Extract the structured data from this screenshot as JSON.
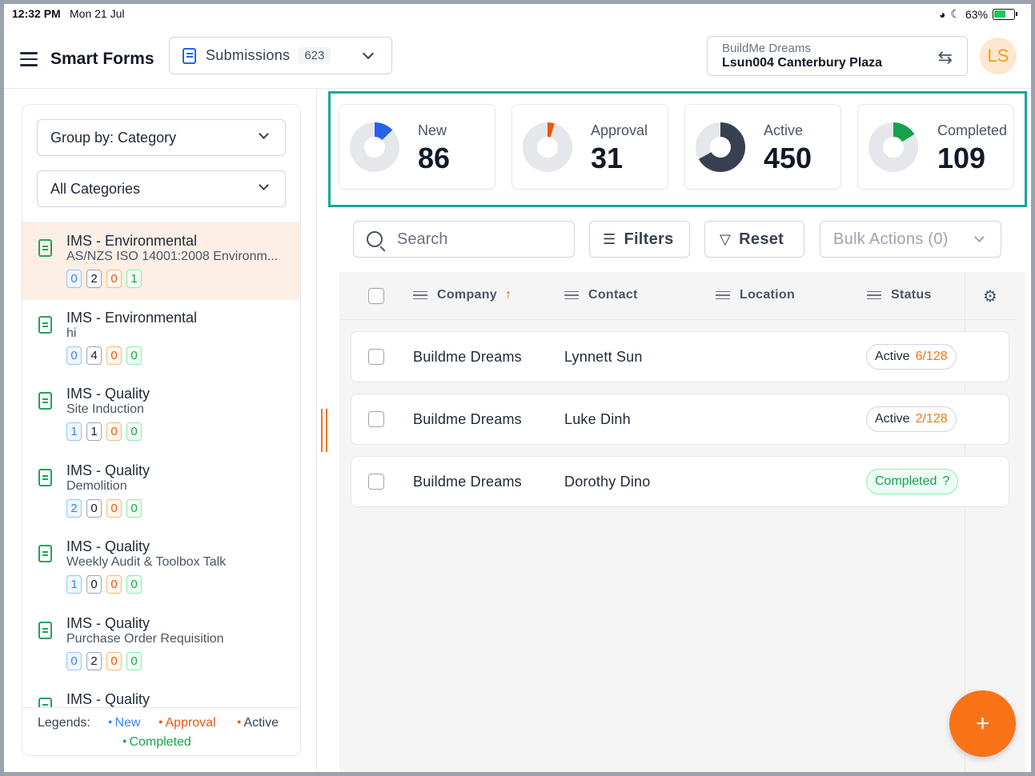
{
  "status_bar": {
    "time": "12:32 PM",
    "date": "Mon 21 Jul",
    "battery": "63%",
    "battery_level": 0.63
  },
  "header": {
    "app_title": "Smart Forms",
    "submissions_label": "Submissions",
    "submissions_count": "623",
    "company": "BuildMe Dreams",
    "project": "Lsun004 Canterbury Plaza",
    "avatar_initials": "LS"
  },
  "sidebar": {
    "group_by": "Group by: Category",
    "category_filter": "All Categories",
    "items": [
      {
        "title": "IMS - Environmental",
        "subtitle": "AS/NZS ISO 14001:2008 Environm...",
        "counts": [
          "0",
          "2",
          "0",
          "1"
        ]
      },
      {
        "title": "IMS - Environmental",
        "subtitle": "hi",
        "counts": [
          "0",
          "4",
          "0",
          "0"
        ]
      },
      {
        "title": "IMS - Quality",
        "subtitle": "Site Induction",
        "counts": [
          "1",
          "1",
          "0",
          "0"
        ]
      },
      {
        "title": "IMS - Quality",
        "subtitle": "Demolition",
        "counts": [
          "2",
          "0",
          "0",
          "0"
        ]
      },
      {
        "title": "IMS - Quality",
        "subtitle": "Weekly Audit & Toolbox Talk",
        "counts": [
          "1",
          "0",
          "0",
          "0"
        ]
      },
      {
        "title": "IMS - Quality",
        "subtitle": "Purchase Order Requisition",
        "counts": [
          "0",
          "2",
          "0",
          "0"
        ]
      },
      {
        "title": "IMS - Quality",
        "subtitle": "",
        "counts": []
      }
    ],
    "legends": {
      "label": "Legends:",
      "new": "New",
      "approval": "Approval",
      "active": "Active",
      "completed": "Completed"
    }
  },
  "stats": [
    {
      "label": "New",
      "value": "86",
      "fraction": 0.128,
      "color": "#2563eb"
    },
    {
      "label": "Approval",
      "value": "31",
      "fraction": 0.046,
      "color": "#ea580c"
    },
    {
      "label": "Active",
      "value": "450",
      "fraction": 0.669,
      "color": "#374151"
    },
    {
      "label": "Completed",
      "value": "109",
      "fraction": 0.162,
      "color": "#16a34a"
    }
  ],
  "toolbar": {
    "search_placeholder": "Search",
    "filters": "Filters",
    "reset": "Reset",
    "bulk_actions": "Bulk Actions (0)"
  },
  "table": {
    "columns": [
      "Company",
      "Contact",
      "Location",
      "Status"
    ],
    "rows": [
      {
        "company": "Buildme Dreams",
        "contact": "Lynnett Sun",
        "location": "",
        "status": "Active",
        "status_count": "6/128"
      },
      {
        "company": "Buildme Dreams",
        "contact": "Luke Dinh",
        "location": "",
        "status": "Active",
        "status_count": "2/128"
      },
      {
        "company": "Buildme Dreams",
        "contact": "Dorothy Dino",
        "location": "",
        "status": "Completed",
        "status_count": "?"
      }
    ]
  },
  "fab_label": "+"
}
